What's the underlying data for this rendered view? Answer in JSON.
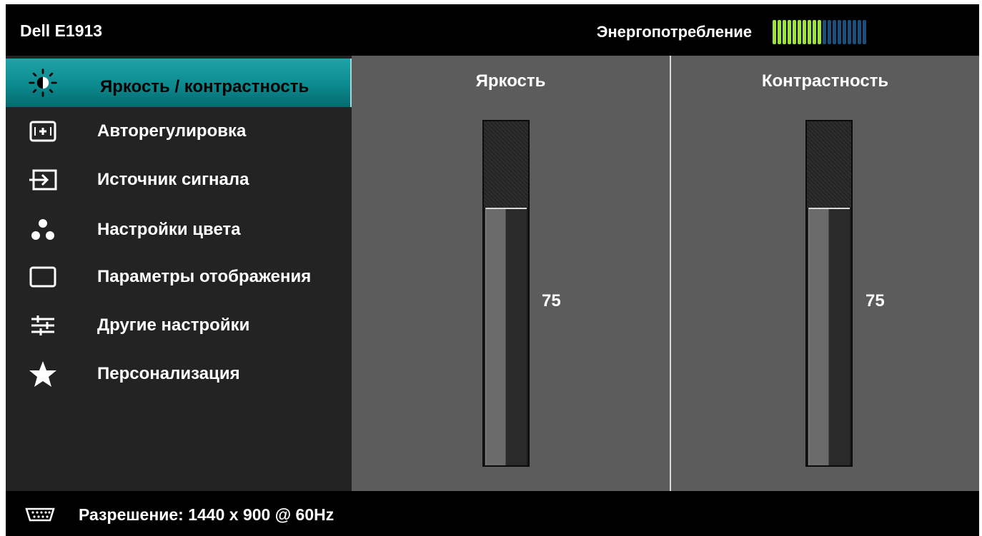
{
  "header": {
    "model": "Dell E1913",
    "power_label": "Энергопотребление",
    "power_meter": {
      "active_segments": 10,
      "total_segments": 19,
      "active_color": "#9be23a",
      "inactive_color": "#1b4f7a"
    }
  },
  "sidebar": {
    "items": [
      {
        "label": "Яркость / контрастность",
        "icon": "brightness-icon",
        "active": true
      },
      {
        "label": "Авторегулировка",
        "icon": "auto-adjust-icon",
        "active": false
      },
      {
        "label": "Источник сигнала",
        "icon": "input-source-icon",
        "active": false
      },
      {
        "label": "Настройки цвета",
        "icon": "color-settings-icon",
        "active": false
      },
      {
        "label": "Параметры отображения",
        "icon": "display-settings-icon",
        "active": false
      },
      {
        "label": "Другие настройки",
        "icon": "other-settings-icon",
        "active": false
      },
      {
        "label": "Персонализация",
        "icon": "star-icon",
        "active": false
      }
    ]
  },
  "main": {
    "brightness": {
      "label": "Яркость",
      "value": "75",
      "level": 75
    },
    "contrast": {
      "label": "Контрастность",
      "value": "75",
      "level": 75
    }
  },
  "footer": {
    "icon": "vga-connector-icon",
    "resolution_text": "Разрешение: 1440 x 900 @ 60Hz"
  },
  "colors": {
    "accent": "#0c8a8f",
    "sidebar_bg": "#232323",
    "content_bg": "#5c5c5c"
  }
}
